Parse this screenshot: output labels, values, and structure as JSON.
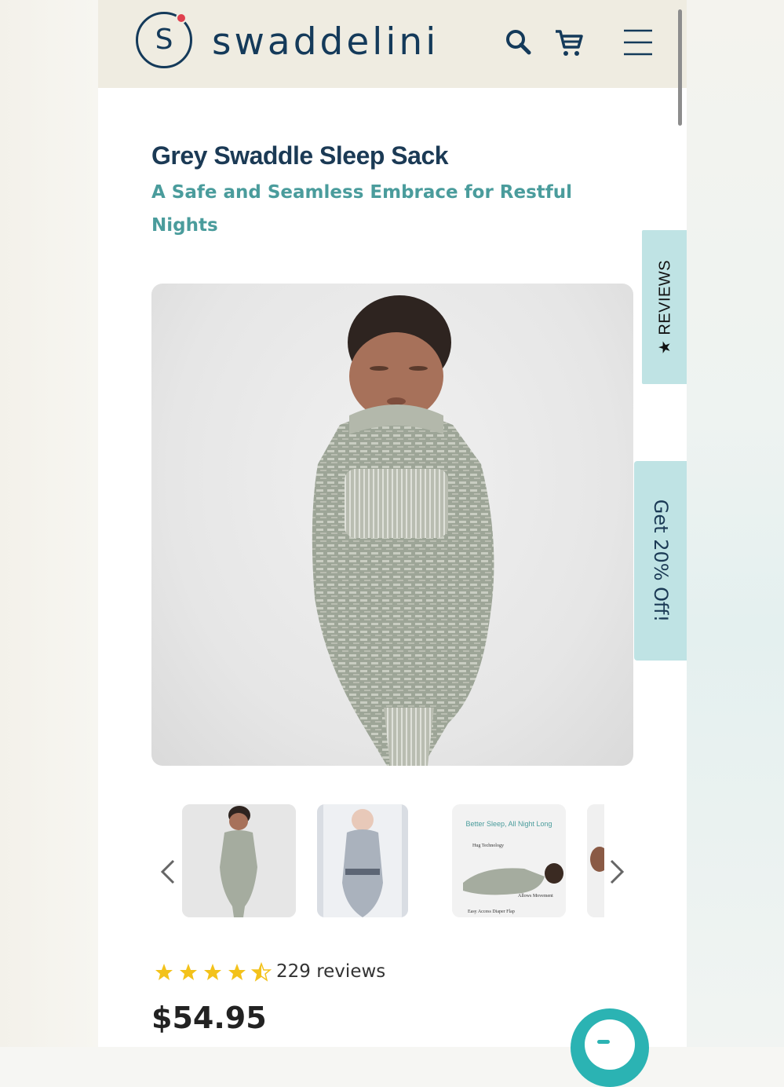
{
  "brand": {
    "name": "swaddelini",
    "mark_letter": "S",
    "color": "#143a5a",
    "dot_color": "#e0404e"
  },
  "header": {
    "icons": [
      "search-icon",
      "cart-icon",
      "hamburger-menu-icon"
    ],
    "background": "#efece1"
  },
  "product": {
    "title": "Grey Swaddle Sleep Sack",
    "subtitle": "A Safe and Seamless Embrace for Restful Nights",
    "accent_color": "#4a9c9c",
    "main_image_alt": "Sleeping newborn wrapped in a grey knit swaddle sleep sack",
    "rating": {
      "value": 4.5,
      "max": 5,
      "count_text": "229 reviews",
      "star_color": "#f3c21b"
    },
    "price": "$54.95"
  },
  "thumbnails": {
    "prev_icon": "chevron-left-icon",
    "next_icon": "chevron-right-icon",
    "items": [
      {
        "alt": "Baby in grey sleep sack"
      },
      {
        "alt": "Baby in sleep sack in bassinet"
      },
      {
        "alt": "Feature diagram",
        "caption": "Better Sleep, All Night Long",
        "notes": [
          "Hug Technology",
          "Allows Movement",
          "Easy Access Diaper Flap"
        ]
      },
      {
        "alt": "Partial image"
      }
    ]
  },
  "side_tabs": {
    "reviews": "★ REVIEWS",
    "offer": "Get 20% Off!",
    "color": "#bfe3e4"
  },
  "chat": {
    "icon": "chat-bubble-icon",
    "color": "#2bb3b3"
  }
}
